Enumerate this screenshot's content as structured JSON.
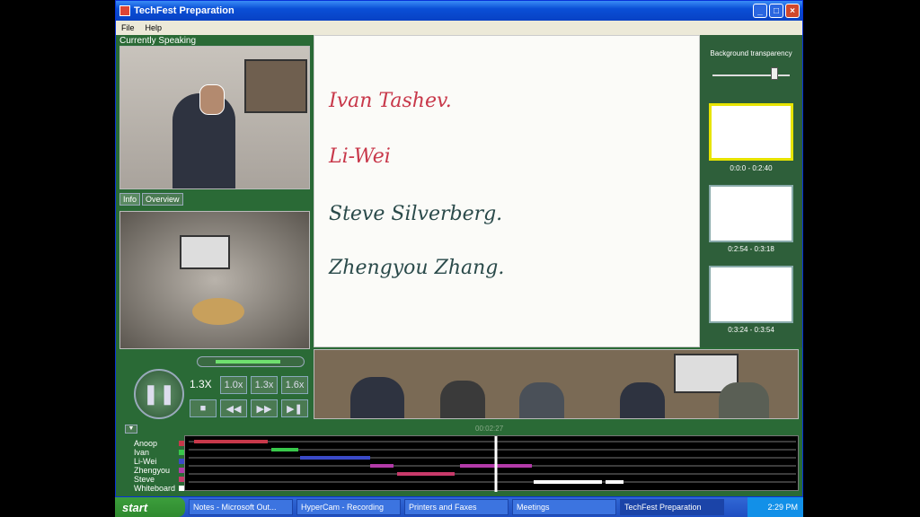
{
  "window": {
    "title": "TechFest Preparation"
  },
  "menu": [
    "File",
    "Help"
  ],
  "left": {
    "currently_speaking_label": "Currently Speaking",
    "tabs": [
      "Info",
      "Overview"
    ]
  },
  "whiteboard": {
    "lines": [
      "Ivan Tashev.",
      "Li-Wei",
      "Steve Silverberg.",
      "Zhengyou Zhang."
    ]
  },
  "right": {
    "transparency_label": "Background transparency",
    "transparency_level": 0.8,
    "thumbnails": [
      {
        "range": "0:0:0 - 0:2:40",
        "selected": true
      },
      {
        "range": "0:2:54 - 0:3:18",
        "selected": false
      },
      {
        "range": "0:3:24 - 0:3:54",
        "selected": false
      }
    ]
  },
  "controls": {
    "speed_display": "1.3X",
    "speed_options": [
      "1.0x",
      "1.3x",
      "1.6x"
    ],
    "volume_level": 0.8
  },
  "timeline": {
    "current_time": "00:02:27",
    "speakers": [
      "Anoop",
      "Ivan",
      "Li-Wei",
      "Zhengyou",
      "Steve",
      "Whiteboard"
    ],
    "speaker_colors": [
      "#c8384a",
      "#38c84a",
      "#3a4ac8",
      "#b23aa8",
      "#c83a6a",
      "#ffffff"
    ]
  },
  "taskbar": {
    "start_label": "start",
    "tasks": [
      "Notes - Microsoft Out...",
      "HyperCam - Recording",
      "Printers and Faxes",
      "Meetings",
      "TechFest Preparation"
    ],
    "active_task": 4,
    "clock": "2:29 PM"
  }
}
